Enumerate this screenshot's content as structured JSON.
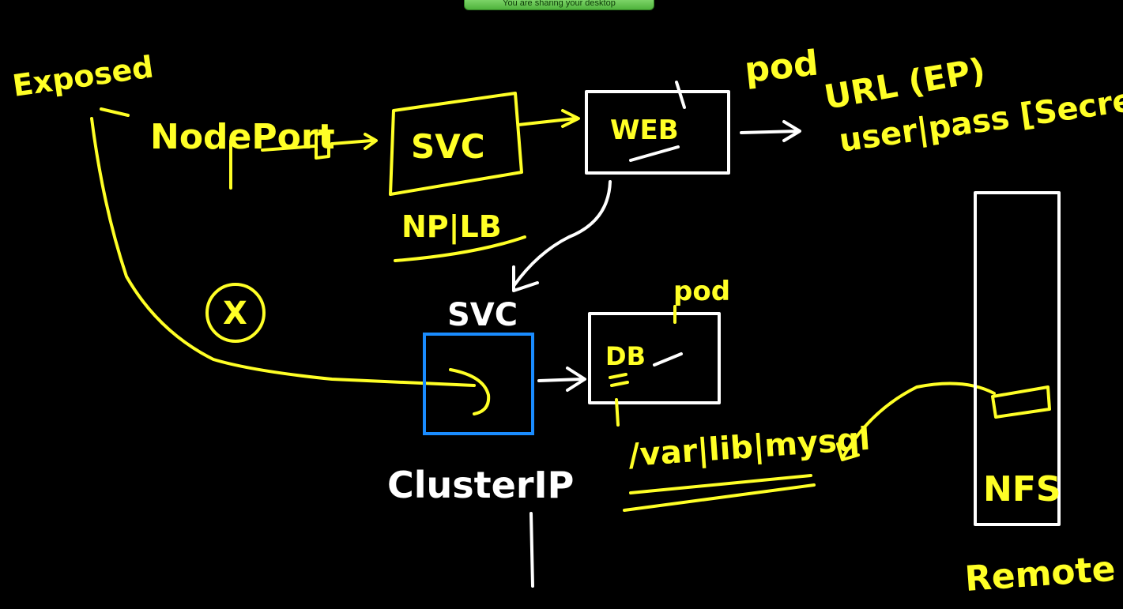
{
  "banner": {
    "text": "You are sharing your desktop"
  },
  "labels": {
    "exposed": "Exposed",
    "nodeport": "NodePort",
    "svc_top": "SVC",
    "web": "WEB",
    "pod_top": "pod",
    "url_ep": "URL (EP)",
    "user_pass": "user|pass [Secret]",
    "np_lb": "NP|LB",
    "x_mark": "X",
    "svc_mid": "SVC",
    "db": "DB",
    "pod_mid": "pod",
    "clusterip": "ClusterIP",
    "mysql_path": "/var|lib|mysql",
    "nfs": "NFS",
    "remote": "Remote"
  },
  "colors": {
    "ink_yellow": "#ffff26",
    "ink_white": "#ffffff",
    "ink_blue": "#1a8cff",
    "background": "#000000"
  }
}
